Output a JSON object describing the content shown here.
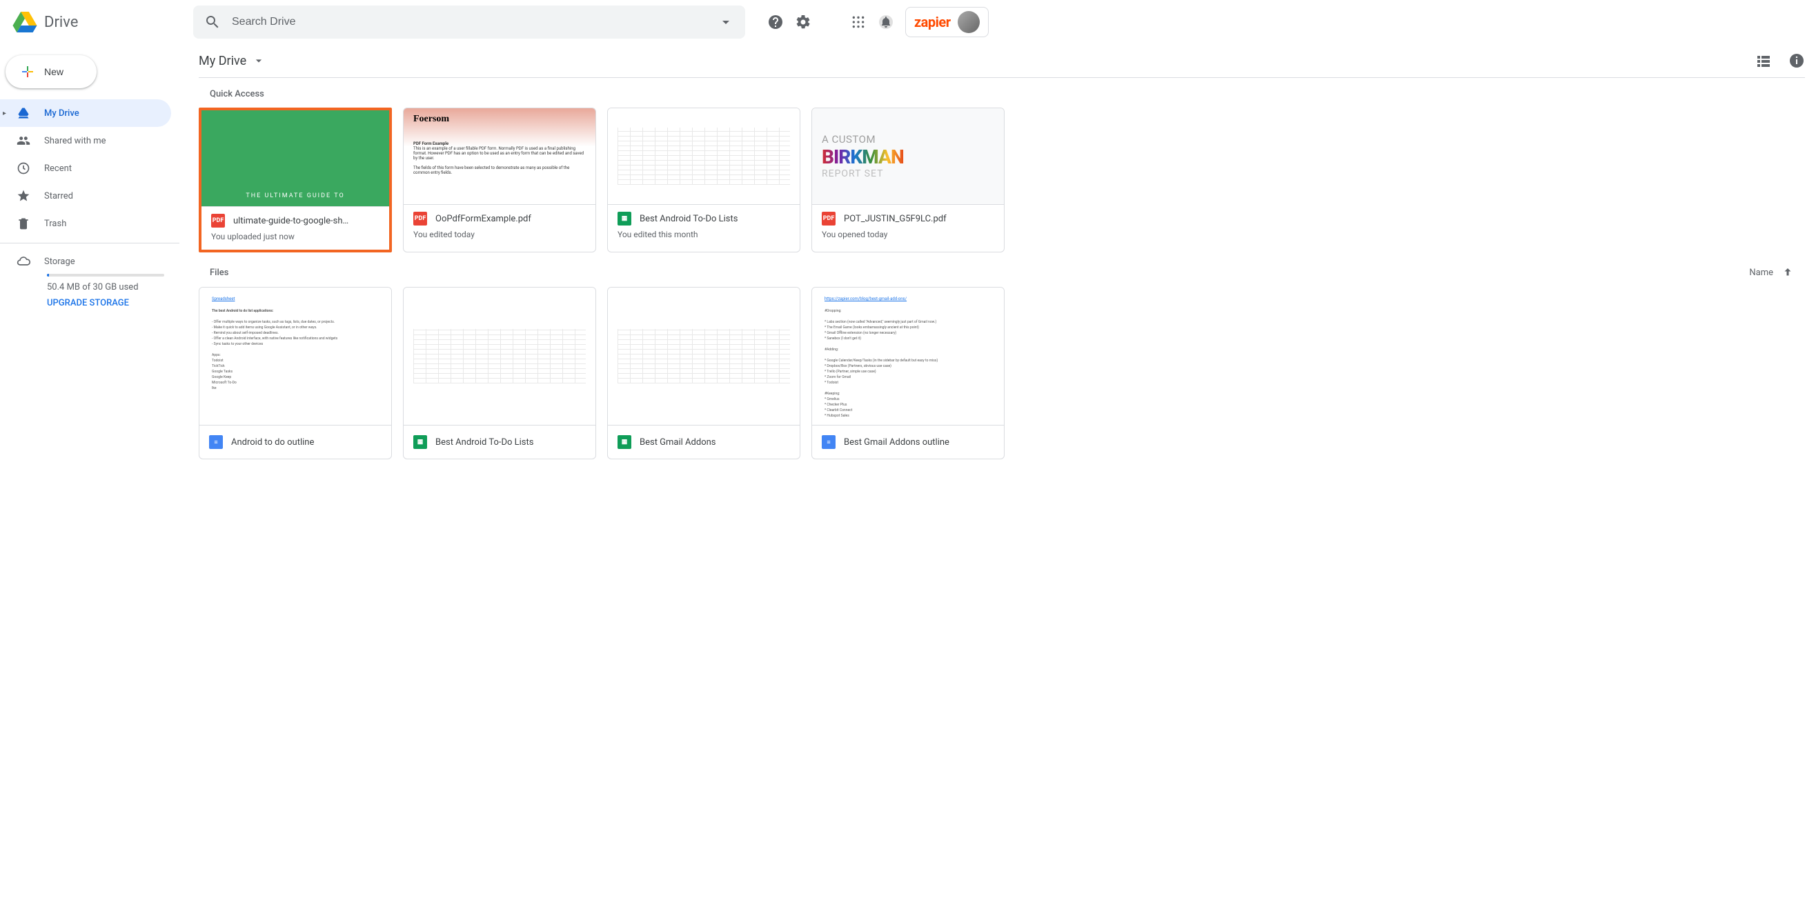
{
  "app": {
    "name": "Drive"
  },
  "search": {
    "placeholder": "Search Drive"
  },
  "header": {
    "brand": "zapier"
  },
  "newButton": {
    "label": "New"
  },
  "sidebar": {
    "items": [
      {
        "key": "my-drive",
        "label": "My Drive",
        "active": true
      },
      {
        "key": "shared",
        "label": "Shared with me"
      },
      {
        "key": "recent",
        "label": "Recent"
      },
      {
        "key": "starred",
        "label": "Starred"
      },
      {
        "key": "trash",
        "label": "Trash"
      }
    ],
    "storage": {
      "label": "Storage",
      "text": "50.4 MB of 30 GB used",
      "upgrade": "UPGRADE STORAGE"
    }
  },
  "breadcrumb": {
    "path": "My Drive"
  },
  "quickAccess": {
    "title": "Quick Access",
    "items": [
      {
        "icon": "pdf",
        "title": "ultimate-guide-to-google-sh…",
        "subtitle": "You uploaded just now",
        "thumbText": "THE ULTIMATE GUIDE TO",
        "highlighted": true
      },
      {
        "icon": "pdf",
        "title": "OoPdfFormExample.pdf",
        "subtitle": "You edited today",
        "pdfHeading": "Foersom",
        "pdfSub": "PDF Form Example"
      },
      {
        "icon": "sheets",
        "title": "Best Android To-Do Lists",
        "subtitle": "You edited this month"
      },
      {
        "icon": "pdf",
        "title": "POT_JUSTIN_G5F9LC.pdf",
        "subtitle": "You opened today",
        "b1": "A CUSTOM",
        "b2": "BIRKMAN",
        "b3": "REPORT SET"
      }
    ]
  },
  "files": {
    "title": "Files",
    "sortLabel": "Name",
    "items": [
      {
        "icon": "docs",
        "title": "Android to do outline"
      },
      {
        "icon": "sheets",
        "title": "Best Android To-Do Lists"
      },
      {
        "icon": "sheets",
        "title": "Best Gmail Addons"
      },
      {
        "icon": "docs",
        "title": "Best Gmail Addons outline"
      }
    ]
  }
}
